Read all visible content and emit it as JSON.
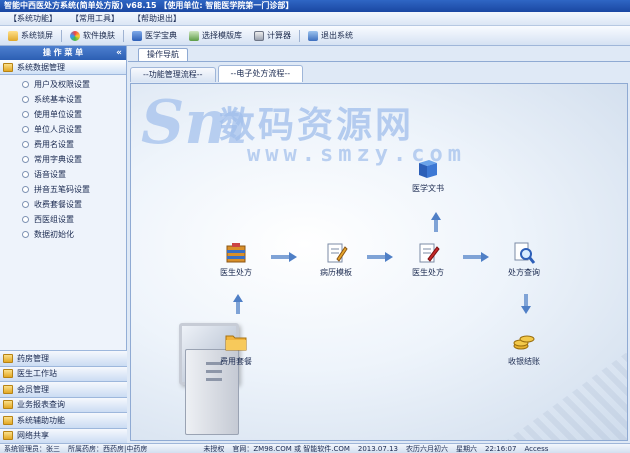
{
  "window": {
    "title": "智能中西医处方系统(简单处方版)  v68.15    【使用单位: 智能医学院第一门诊部】"
  },
  "menu": [
    "【系统功能】",
    "【常用工具】",
    "【帮助退出】"
  ],
  "toolbar": [
    "系统锁屏",
    "软件换肤",
    "医学宝典",
    "选择模版库",
    "计算器",
    "退出系统"
  ],
  "sidebar": {
    "header": "操 作 菜 单",
    "collapse": "«",
    "open_group": "系统数据管理",
    "items": [
      "用户及权限设置",
      "系统基本设置",
      "使用单位设置",
      "单位人员设置",
      "费用名设置",
      "常用字典设置",
      "语音设置",
      "拼音五笔码设置",
      "收费套餐设置",
      "西医组设置",
      "数据初始化"
    ],
    "groups": [
      "药房管理",
      "医生工作站",
      "会员管理",
      "业务报表查询",
      "系统辅助功能",
      "网络共享"
    ]
  },
  "main": {
    "tab": "操作导航",
    "subtabs": [
      "--功能管理流程--",
      "--电子处方流程--"
    ],
    "active_subtab": 1
  },
  "watermark": {
    "cn": "数码资源网",
    "url": "www.smzy.com"
  },
  "flow": {
    "nodes": {
      "doctor_kit": "医生处方",
      "template": "病历模板",
      "prescription": "医生处方",
      "query": "处方查询",
      "docs": "医学文书",
      "fees": "费用套餐",
      "charge": "收银结账"
    },
    "arrow_label": "⇒"
  },
  "status": [
    "系统管理员：张三",
    "所属药房：西药房|中药房",
    "未授权",
    "官网：ZM98.COM 或 智能软件.COM",
    "2013.07.13",
    "农历六月初六",
    "星期六",
    "22:16:07",
    "Access"
  ]
}
